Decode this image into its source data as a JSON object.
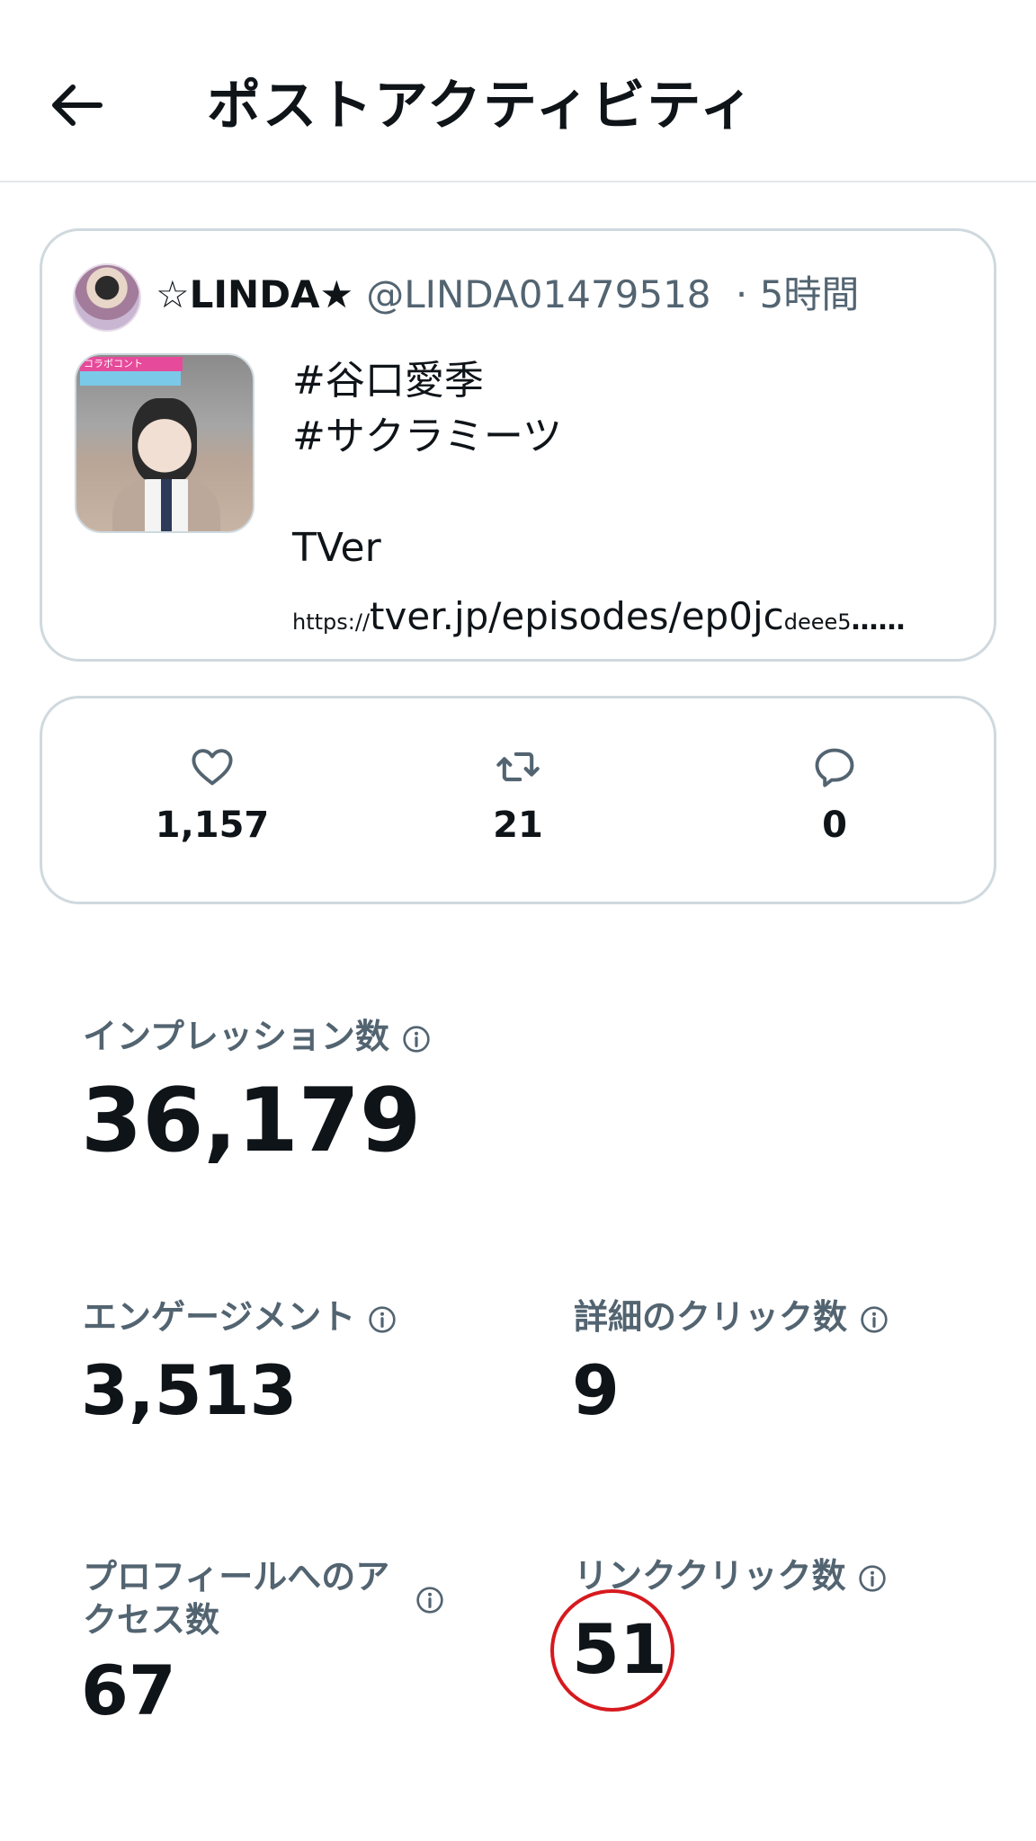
{
  "header": {
    "title": "ポストアクティビティ"
  },
  "post": {
    "display_name": "☆LINDA★",
    "handle": "@LINDA01479518",
    "time": "· 5時間",
    "text": "#谷口愛季\n#サクラミーツ\n\nTVer",
    "link": {
      "scheme": "https://",
      "main": "tver.jp/episodes/ep0jc",
      "tail": "deee5",
      "ellipsis": "……"
    },
    "thumbnail_badge": "コラボコント"
  },
  "stats": {
    "likes": "1,157",
    "reposts": "21",
    "replies": "0"
  },
  "metrics": {
    "impressions": {
      "label": "インプレッション数",
      "value": "36,179"
    },
    "engagements": {
      "label": "エンゲージメント",
      "value": "3,513"
    },
    "detail_clicks": {
      "label": "詳細のクリック数",
      "value": "9"
    },
    "profile_visits": {
      "label": "プロフィールへのア\nクセス数",
      "value": "67"
    },
    "link_clicks": {
      "label": "リンククリック数",
      "value": "51"
    }
  },
  "colors": {
    "text": "#0f1419",
    "secondary": "#536471",
    "border": "#cfd9de",
    "highlight_circle": "#d61a1f"
  },
  "icons": [
    "back-arrow-icon",
    "heart-icon",
    "repost-icon",
    "reply-icon",
    "info-icon"
  ]
}
